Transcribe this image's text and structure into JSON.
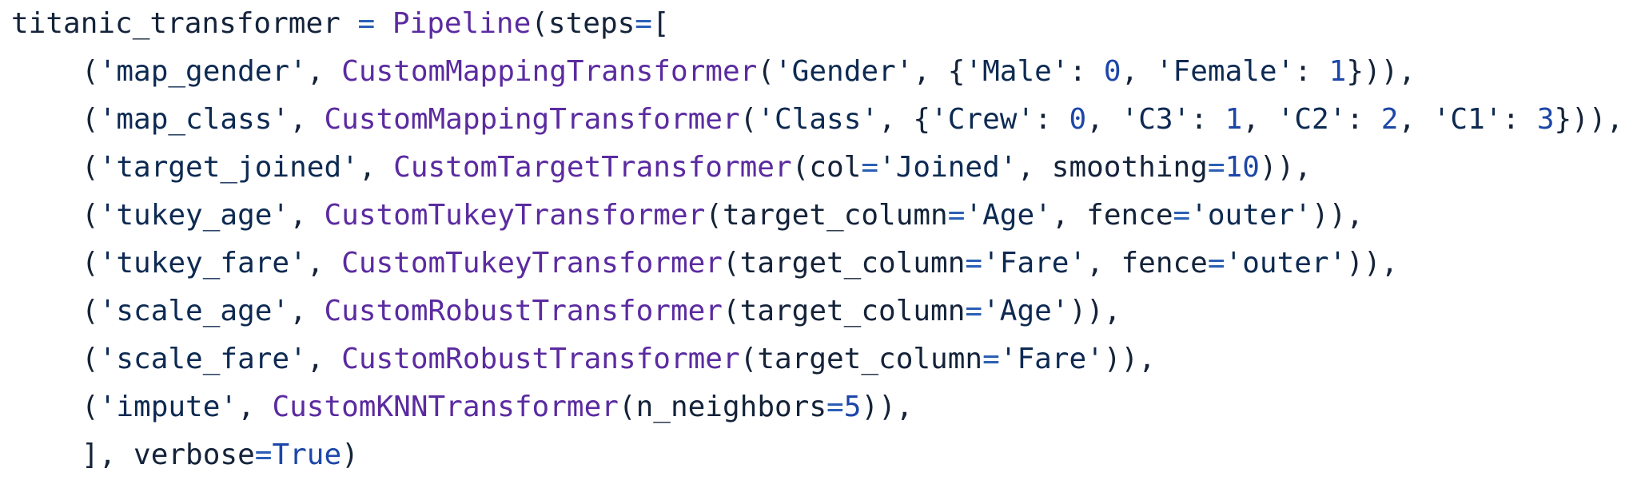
{
  "colors": {
    "background": "#ffffff",
    "default_text": "#14233a",
    "string": "#0d2a52",
    "class_name": "#5b2ba0",
    "number": "#1c46a8",
    "operator": "#2a5fb5",
    "keyword_constant": "#1c46a8"
  },
  "code": {
    "language": "python",
    "lines": [
      [
        {
          "t": "titanic_transformer ",
          "k": "default"
        },
        {
          "t": "=",
          "k": "op"
        },
        {
          "t": " ",
          "k": "default"
        },
        {
          "t": "Pipeline",
          "k": "class"
        },
        {
          "t": "(steps",
          "k": "default"
        },
        {
          "t": "=",
          "k": "op"
        },
        {
          "t": "[",
          "k": "default"
        }
      ],
      [
        {
          "t": "    ",
          "k": "indent"
        },
        {
          "t": "(",
          "k": "default"
        },
        {
          "t": "'map_gender'",
          "k": "string"
        },
        {
          "t": ", ",
          "k": "default"
        },
        {
          "t": "CustomMappingTransformer",
          "k": "class"
        },
        {
          "t": "(",
          "k": "default"
        },
        {
          "t": "'Gender'",
          "k": "string"
        },
        {
          "t": ", {",
          "k": "default"
        },
        {
          "t": "'Male'",
          "k": "string"
        },
        {
          "t": ": ",
          "k": "default"
        },
        {
          "t": "0",
          "k": "number"
        },
        {
          "t": ", ",
          "k": "default"
        },
        {
          "t": "'Female'",
          "k": "string"
        },
        {
          "t": ": ",
          "k": "default"
        },
        {
          "t": "1",
          "k": "number"
        },
        {
          "t": "})),",
          "k": "default"
        }
      ],
      [
        {
          "t": "    ",
          "k": "indent"
        },
        {
          "t": "(",
          "k": "default"
        },
        {
          "t": "'map_class'",
          "k": "string"
        },
        {
          "t": ", ",
          "k": "default"
        },
        {
          "t": "CustomMappingTransformer",
          "k": "class"
        },
        {
          "t": "(",
          "k": "default"
        },
        {
          "t": "'Class'",
          "k": "string"
        },
        {
          "t": ", {",
          "k": "default"
        },
        {
          "t": "'Crew'",
          "k": "string"
        },
        {
          "t": ": ",
          "k": "default"
        },
        {
          "t": "0",
          "k": "number"
        },
        {
          "t": ", ",
          "k": "default"
        },
        {
          "t": "'C3'",
          "k": "string"
        },
        {
          "t": ": ",
          "k": "default"
        },
        {
          "t": "1",
          "k": "number"
        },
        {
          "t": ", ",
          "k": "default"
        },
        {
          "t": "'C2'",
          "k": "string"
        },
        {
          "t": ": ",
          "k": "default"
        },
        {
          "t": "2",
          "k": "number"
        },
        {
          "t": ", ",
          "k": "default"
        },
        {
          "t": "'C1'",
          "k": "string"
        },
        {
          "t": ": ",
          "k": "default"
        },
        {
          "t": "3",
          "k": "number"
        },
        {
          "t": "})),",
          "k": "default"
        }
      ],
      [
        {
          "t": "    ",
          "k": "indent"
        },
        {
          "t": "(",
          "k": "default"
        },
        {
          "t": "'target_joined'",
          "k": "string"
        },
        {
          "t": ", ",
          "k": "default"
        },
        {
          "t": "CustomTargetTransformer",
          "k": "class"
        },
        {
          "t": "(col",
          "k": "default"
        },
        {
          "t": "=",
          "k": "op"
        },
        {
          "t": "'Joined'",
          "k": "string"
        },
        {
          "t": ", smoothing",
          "k": "default"
        },
        {
          "t": "=",
          "k": "op"
        },
        {
          "t": "10",
          "k": "number"
        },
        {
          "t": ")),",
          "k": "default"
        }
      ],
      [
        {
          "t": "    ",
          "k": "indent"
        },
        {
          "t": "(",
          "k": "default"
        },
        {
          "t": "'tukey_age'",
          "k": "string"
        },
        {
          "t": ", ",
          "k": "default"
        },
        {
          "t": "CustomTukeyTransformer",
          "k": "class"
        },
        {
          "t": "(target_column",
          "k": "default"
        },
        {
          "t": "=",
          "k": "op"
        },
        {
          "t": "'Age'",
          "k": "string"
        },
        {
          "t": ", fence",
          "k": "default"
        },
        {
          "t": "=",
          "k": "op"
        },
        {
          "t": "'outer'",
          "k": "string"
        },
        {
          "t": ")),",
          "k": "default"
        }
      ],
      [
        {
          "t": "    ",
          "k": "indent"
        },
        {
          "t": "(",
          "k": "default"
        },
        {
          "t": "'tukey_fare'",
          "k": "string"
        },
        {
          "t": ", ",
          "k": "default"
        },
        {
          "t": "CustomTukeyTransformer",
          "k": "class"
        },
        {
          "t": "(target_column",
          "k": "default"
        },
        {
          "t": "=",
          "k": "op"
        },
        {
          "t": "'Fare'",
          "k": "string"
        },
        {
          "t": ", fence",
          "k": "default"
        },
        {
          "t": "=",
          "k": "op"
        },
        {
          "t": "'outer'",
          "k": "string"
        },
        {
          "t": ")),",
          "k": "default"
        }
      ],
      [
        {
          "t": "    ",
          "k": "indent"
        },
        {
          "t": "(",
          "k": "default"
        },
        {
          "t": "'scale_age'",
          "k": "string"
        },
        {
          "t": ", ",
          "k": "default"
        },
        {
          "t": "CustomRobustTransformer",
          "k": "class"
        },
        {
          "t": "(target_column",
          "k": "default"
        },
        {
          "t": "=",
          "k": "op"
        },
        {
          "t": "'Age'",
          "k": "string"
        },
        {
          "t": ")),",
          "k": "default"
        }
      ],
      [
        {
          "t": "    ",
          "k": "indent"
        },
        {
          "t": "(",
          "k": "default"
        },
        {
          "t": "'scale_fare'",
          "k": "string"
        },
        {
          "t": ", ",
          "k": "default"
        },
        {
          "t": "CustomRobustTransformer",
          "k": "class"
        },
        {
          "t": "(target_column",
          "k": "default"
        },
        {
          "t": "=",
          "k": "op"
        },
        {
          "t": "'Fare'",
          "k": "string"
        },
        {
          "t": ")),",
          "k": "default"
        }
      ],
      [
        {
          "t": "    ",
          "k": "indent"
        },
        {
          "t": "(",
          "k": "default"
        },
        {
          "t": "'impute'",
          "k": "string"
        },
        {
          "t": ", ",
          "k": "default"
        },
        {
          "t": "CustomKNNTransformer",
          "k": "class"
        },
        {
          "t": "(n_neighbors",
          "k": "default"
        },
        {
          "t": "=",
          "k": "op"
        },
        {
          "t": "5",
          "k": "number"
        },
        {
          "t": ")),",
          "k": "default"
        }
      ],
      [
        {
          "t": "    ",
          "k": "indent"
        },
        {
          "t": "], verbose",
          "k": "default"
        },
        {
          "t": "=",
          "k": "op"
        },
        {
          "t": "True",
          "k": "keyword"
        },
        {
          "t": ")",
          "k": "default"
        }
      ]
    ]
  }
}
